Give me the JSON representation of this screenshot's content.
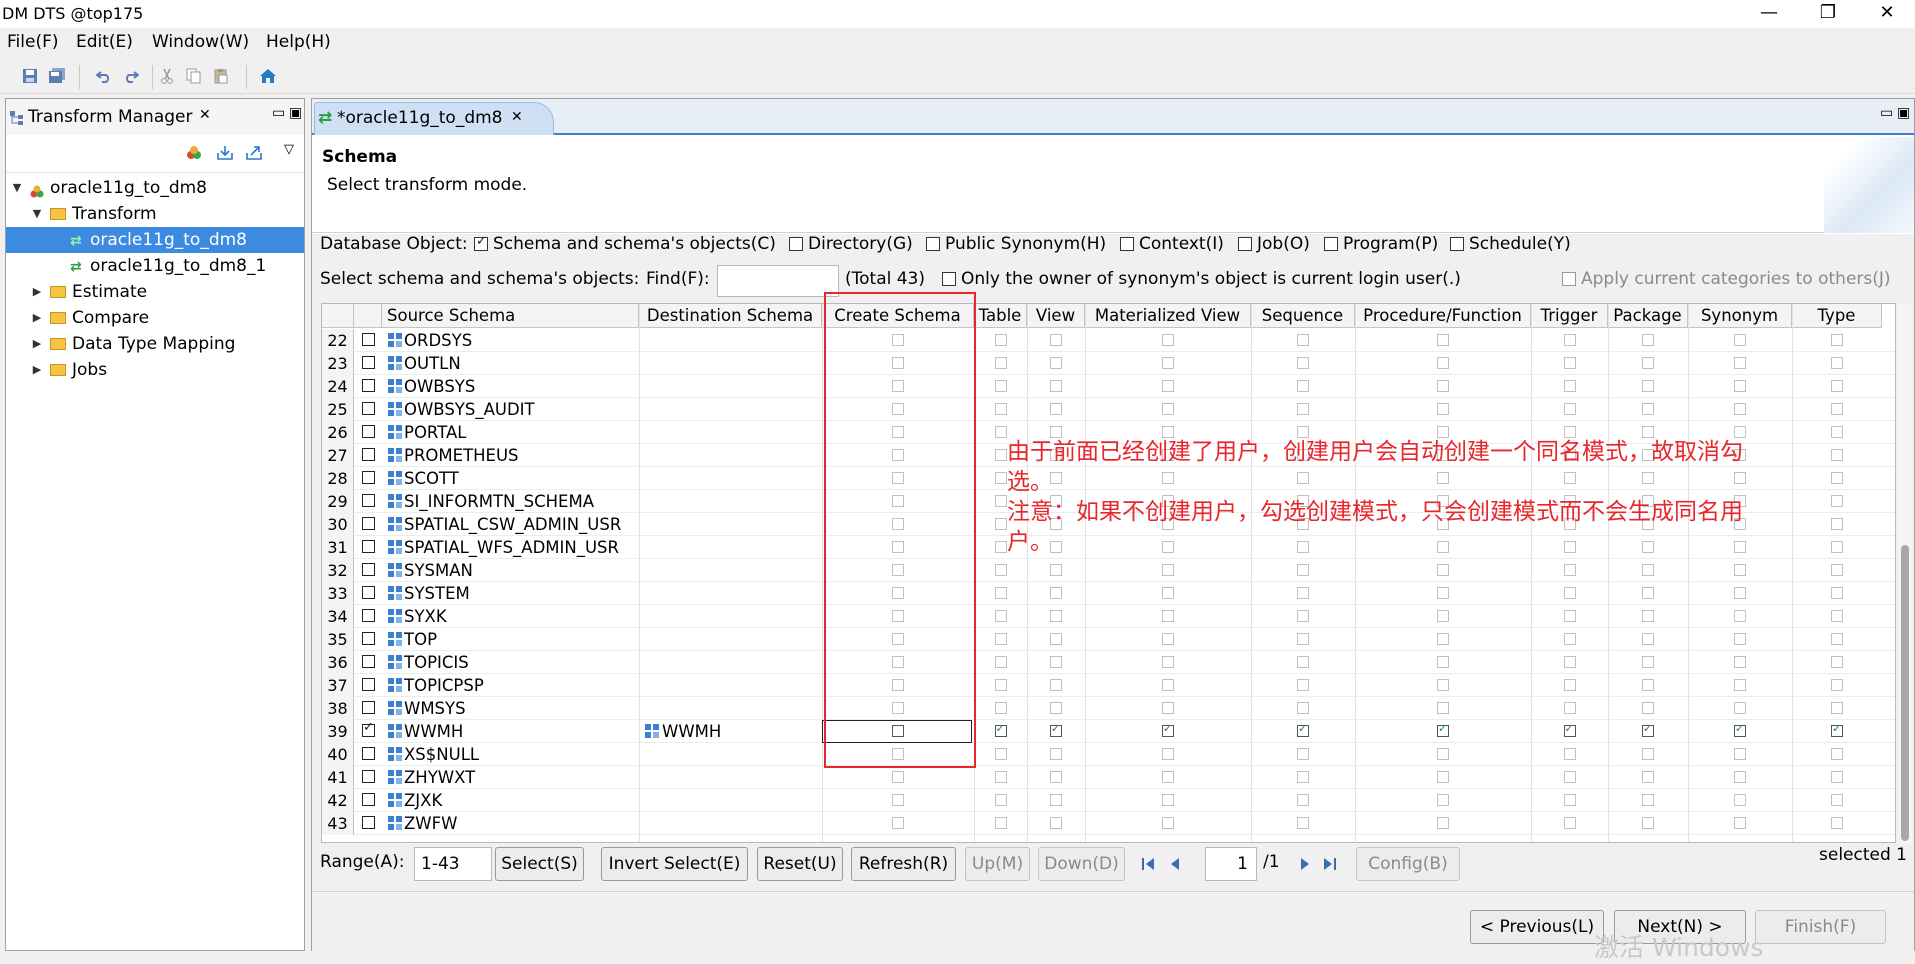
{
  "window": {
    "title": "DM DTS @top175",
    "minimize_glyph": "—",
    "maximize_glyph": "❐",
    "close_glyph": "✕"
  },
  "menu": [
    "File(F)",
    "Edit(E)",
    "Window(W)",
    "Help(H)"
  ],
  "toolbar": {
    "icons": [
      "save-icon",
      "save-all-icon",
      "undo-icon",
      "redo-icon",
      "cut-icon",
      "copy-icon",
      "paste-icon",
      "home-icon"
    ]
  },
  "left_panel": {
    "tab_label": "Transform Manager",
    "tree": [
      {
        "label": "oracle11g_to_dm8",
        "level": 0,
        "expanded": true,
        "kind": "project"
      },
      {
        "label": "Transform",
        "level": 1,
        "expanded": true,
        "kind": "folder"
      },
      {
        "label": "oracle11g_to_dm8",
        "level": 2,
        "kind": "transform",
        "selected": true
      },
      {
        "label": "oracle11g_to_dm8_1",
        "level": 2,
        "kind": "transform"
      },
      {
        "label": "Estimate",
        "level": 1,
        "expanded": false,
        "kind": "folder"
      },
      {
        "label": "Compare",
        "level": 1,
        "expanded": false,
        "kind": "folder"
      },
      {
        "label": "Data Type Mapping",
        "level": 1,
        "expanded": false,
        "kind": "folder"
      },
      {
        "label": "Jobs",
        "level": 1,
        "expanded": false,
        "kind": "folder"
      }
    ]
  },
  "editor": {
    "tab_label": "*oracle11g_to_dm8",
    "wizard_title": "Schema",
    "wizard_desc": "Select transform mode.",
    "db_object_label": "Database Object:",
    "db_objects": [
      {
        "label": "Schema and schema's objects(C)",
        "checked": true
      },
      {
        "label": "Directory(G)",
        "checked": false
      },
      {
        "label": "Public Synonym(H)",
        "checked": false
      },
      {
        "label": "Context(I)",
        "checked": false
      },
      {
        "label": "Job(O)",
        "checked": false
      },
      {
        "label": "Program(P)",
        "checked": false
      },
      {
        "label": "Schedule(Y)",
        "checked": false
      }
    ],
    "select_label": "Select schema and schema's objects:",
    "find_label": "Find(F):",
    "find_value": "",
    "total_text": "(Total 43)",
    "owner_option": "Only the owner of synonym's object is current login user(.)",
    "apply_option": "Apply current categories to others(J)",
    "columns": [
      "Source Schema",
      "Destination Schema",
      "Create Schema",
      "Table",
      "View",
      "Materialized View",
      "Sequence",
      "Procedure/Function",
      "Trigger",
      "Package",
      "Synonym",
      "Type"
    ],
    "rows": [
      {
        "num": "22",
        "source": "ORDSYS",
        "dest": "",
        "checked": false
      },
      {
        "num": "23",
        "source": "OUTLN",
        "dest": "",
        "checked": false
      },
      {
        "num": "24",
        "source": "OWBSYS",
        "dest": "",
        "checked": false
      },
      {
        "num": "25",
        "source": "OWBSYS_AUDIT",
        "dest": "",
        "checked": false
      },
      {
        "num": "26",
        "source": "PORTAL",
        "dest": "",
        "checked": false
      },
      {
        "num": "27",
        "source": "PROMETHEUS",
        "dest": "",
        "checked": false
      },
      {
        "num": "28",
        "source": "SCOTT",
        "dest": "",
        "checked": false
      },
      {
        "num": "29",
        "source": "SI_INFORMTN_SCHEMA",
        "dest": "",
        "checked": false
      },
      {
        "num": "30",
        "source": "SPATIAL_CSW_ADMIN_USR",
        "dest": "",
        "checked": false
      },
      {
        "num": "31",
        "source": "SPATIAL_WFS_ADMIN_USR",
        "dest": "",
        "checked": false
      },
      {
        "num": "32",
        "source": "SYSMAN",
        "dest": "",
        "checked": false
      },
      {
        "num": "33",
        "source": "SYSTEM",
        "dest": "",
        "checked": false
      },
      {
        "num": "34",
        "source": "SYXK",
        "dest": "",
        "checked": false
      },
      {
        "num": "35",
        "source": "TOP",
        "dest": "",
        "checked": false
      },
      {
        "num": "36",
        "source": "TOPICIS",
        "dest": "",
        "checked": false
      },
      {
        "num": "37",
        "source": "TOPICPSP",
        "dest": "",
        "checked": false
      },
      {
        "num": "38",
        "source": "WMSYS",
        "dest": "",
        "checked": false
      },
      {
        "num": "39",
        "source": "WWMH",
        "dest": "WWMH",
        "checked": true
      },
      {
        "num": "40",
        "source": "XS$NULL",
        "dest": "",
        "checked": false
      },
      {
        "num": "41",
        "source": "ZHYWXT",
        "dest": "",
        "checked": false
      },
      {
        "num": "42",
        "source": "ZJXK",
        "dest": "",
        "checked": false
      },
      {
        "num": "43",
        "source": "ZWFW",
        "dest": "",
        "checked": false
      }
    ],
    "annotation_lines": [
      "由于前面已经创建了用户，创建用户会自动创建一个同名模式，故取消勾",
      "选。",
      "注意：如果不创建用户，勾选创建模式，只会创建模式而不会生成同名用",
      "户。"
    ],
    "range_label": "Range(A):",
    "range_value": "1-43",
    "buttons": {
      "select": "Select(S)",
      "invert": "Invert Select(E)",
      "reset": "Reset(U)",
      "refresh": "Refresh(R)",
      "up": "Up(M)",
      "down": "Down(D)",
      "config": "Config(B)",
      "previous": "< Previous(L)",
      "next": "Next(N) >",
      "finish": "Finish(F)"
    },
    "page_value": "1",
    "page_total": "/1",
    "selected_text": "selected 1",
    "watermark": "激活 Windows"
  }
}
